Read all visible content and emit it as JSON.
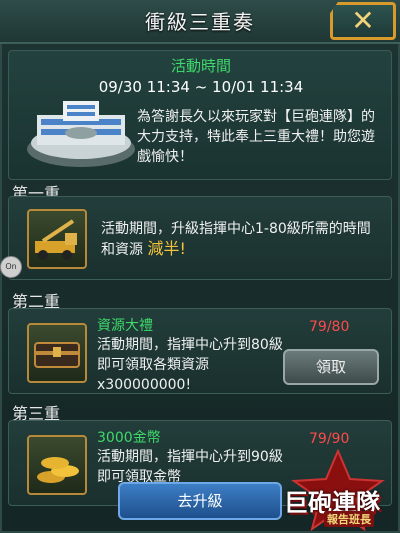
{
  "window": {
    "title": "衝級三重奏",
    "close_symbol": "✕"
  },
  "event": {
    "time_label": "活動時間",
    "time_range": "09/30 11:34 ~ 10/01 11:34",
    "description": "為答謝長久以來玩家對【巨砲連隊】的大力支持，特此奉上三重大禮！助您遊戲愉快！"
  },
  "tiers": [
    {
      "label": "第一重",
      "description": "活動期間，升級指揮中心1-80級所需的時間和資源",
      "highlight": "減半!"
    },
    {
      "label": "第二重",
      "title": "資源大禮",
      "description": "活動期間，指揮中心升到80級即可領取各類資源x300000000!",
      "progress": "79/80",
      "claim_label": "領取"
    },
    {
      "label": "第三重",
      "title": "3000金幣",
      "description": "活動期間，指揮中心升到90級即可領取金幣",
      "progress": "79/90"
    }
  ],
  "upgrade_button": "去升級",
  "logo": {
    "main": "巨砲連隊",
    "sub": "報告班長"
  },
  "side_tab": "On",
  "colors": {
    "accent_green": "#3fd86a",
    "progress_red": "#ff4a4a",
    "highlight_gold": "#f2c23a"
  }
}
